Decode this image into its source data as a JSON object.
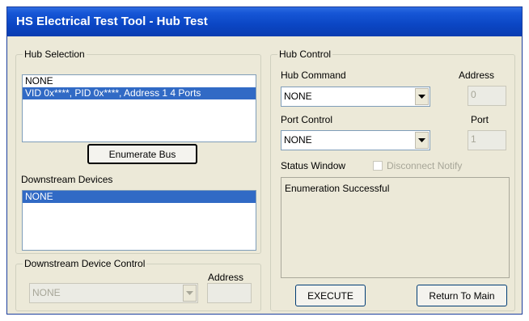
{
  "window": {
    "title": "HS Electrical Test Tool - Hub Test"
  },
  "hub_selection": {
    "legend": "Hub Selection",
    "items": [
      {
        "label": "NONE",
        "selected": false
      },
      {
        "label": "VID 0x****, PID 0x****, Address 1  4 Ports",
        "selected": true
      }
    ],
    "enumerate_button": "Enumerate Bus",
    "downstream_label": "Downstream Devices",
    "downstream_items": [
      {
        "label": "NONE",
        "selected": true
      }
    ]
  },
  "downstream_control": {
    "legend": "Downstream Device Control",
    "address_label": "Address",
    "combo_value": "NONE",
    "address_value": ""
  },
  "hub_control": {
    "legend": "Hub Control",
    "hub_command_label": "Hub Command",
    "address_label": "Address",
    "hub_command_value": "NONE",
    "address_value": "0",
    "port_control_label": "Port Control",
    "port_label": "Port",
    "port_control_value": "NONE",
    "port_value": "1",
    "status_window_label": "Status Window",
    "disconnect_notify_label": "Disconnect Notify",
    "disconnect_notify_checked": false,
    "status_text": "Enumeration Successful",
    "execute_button": "EXECUTE",
    "return_button": "Return To Main"
  },
  "icons": {
    "combo_arrow": "chevron-down-icon"
  }
}
